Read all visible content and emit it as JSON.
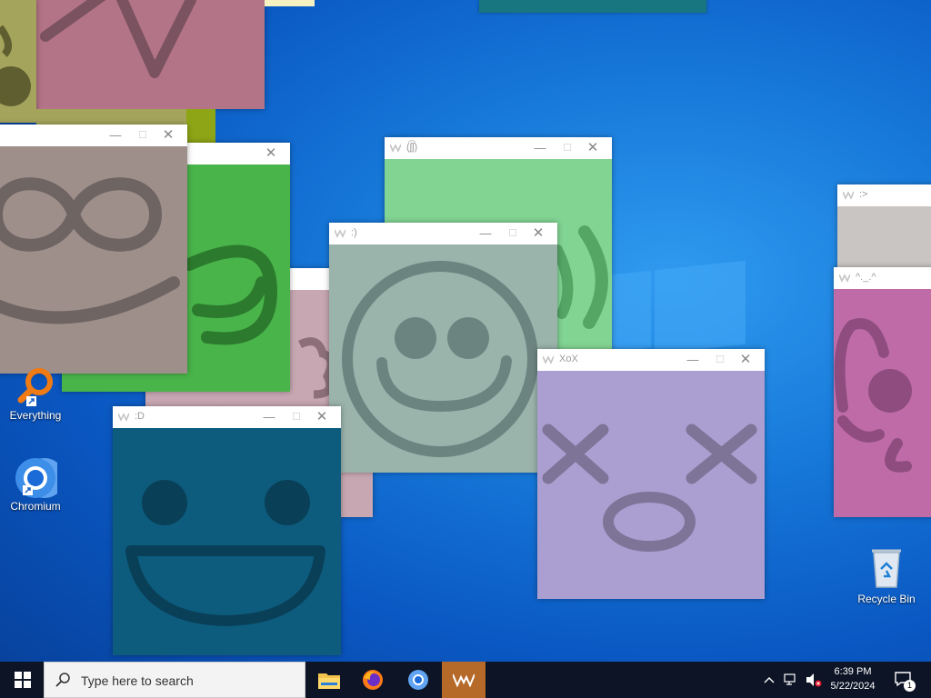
{
  "windows": [
    {
      "id": "win-arrow",
      "title": "",
      "bg": "#b27486",
      "face": "face-arrow"
    },
    {
      "id": "win-olive",
      "title": "",
      "bg": "#a4a45c",
      "face": "face-blob"
    },
    {
      "id": "win-green",
      "title": "",
      "bg": "#49b44a",
      "face": "face-smirk"
    },
    {
      "id": "win-infinity",
      "title": "",
      "bg": "#9e8f8a",
      "face": "face-infinity"
    },
    {
      "id": "win-lightgreen",
      "title": "(ʃ͡ʃ)",
      "bg": "#82d493",
      "face": "face-paren"
    },
    {
      "id": "win-smile",
      "title": ":)",
      "bg": "#9ab3ab",
      "face": "face-smile"
    },
    {
      "id": "win-pink",
      "title": "",
      "bg": "#c7a7b2",
      "face": "face-scribble"
    },
    {
      "id": "win-bigd",
      "title": ":D",
      "bg": "#0d5c7e",
      "face": "face-bigd"
    },
    {
      "id": "win-xox",
      "title": "XoX",
      "bg": "#ab9fd1",
      "face": "face-xox"
    },
    {
      "id": "win-grey",
      "title": ":>",
      "bg": "#c9c5c2",
      "face": ""
    },
    {
      "id": "win-magenta",
      "title": "^._.^",
      "bg": "#bf6ba8",
      "face": "face-cat"
    }
  ],
  "window_controls": {
    "minimize": "—",
    "maximize": "☐",
    "close": "✕"
  },
  "desktop_icons": {
    "everything": {
      "label": "Everything",
      "icon": "magnifier-icon"
    },
    "chromium": {
      "label": "Chromium",
      "icon": "chromium-icon"
    },
    "recycle_bin": {
      "label": "Recycle Bin",
      "icon": "recycle-bin-icon"
    }
  },
  "taskbar": {
    "search_placeholder": "Type here to search",
    "apps": [
      "file-explorer-icon",
      "firefox-icon",
      "chromium-icon",
      "wave-app-icon"
    ],
    "active_app": "wave-app-icon",
    "time": "6:39 PM",
    "date": "5/22/2024",
    "notification_count": "1"
  }
}
